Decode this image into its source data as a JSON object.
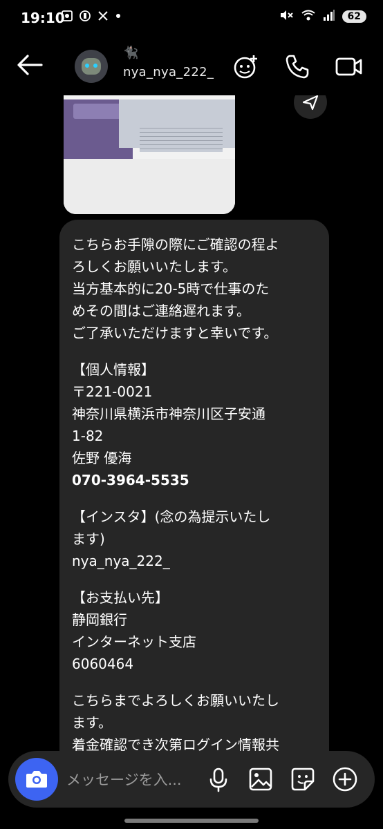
{
  "status_bar": {
    "time": "19:10",
    "battery": "62",
    "left_icons": [
      "screen-record-icon",
      "app-icon",
      "x-app-icon",
      "dot-icon"
    ],
    "right_icons": [
      "mute-icon",
      "wifi-icon",
      "signal-icon",
      "battery-icon"
    ]
  },
  "header": {
    "username": "nya_nya_222_",
    "username_emoji": "🐈‍⬛",
    "icons": [
      "back-arrow-icon",
      "effects-icon",
      "phone-icon",
      "video-icon"
    ]
  },
  "message": {
    "lines": [
      "こちらお手隙の際にご確認の程よ",
      "ろしくお願いいたします。",
      "当方基本的に20-5時で仕事のた",
      "めその間はご連絡遅れます。",
      "ご了承いただけますと幸いです。",
      "",
      "【個人情報】",
      "〒221-0021",
      "神奈川県横浜市神奈川区子安通",
      "1-82",
      "佐野 優海",
      "070-3964-5535",
      "",
      "【インスタ】(念の為提示いたし",
      "ます)",
      "nya_nya_222_",
      "",
      "【お支払い先】",
      "静岡銀行",
      "インターネット支店",
      "6060464",
      "",
      "こちらまでよろしくお願いいたし",
      "ます。",
      "着金確認でき次第ログイン情報共"
    ]
  },
  "composer": {
    "placeholder": "メッセージを入...",
    "icons": [
      "camera-icon",
      "microphone-icon",
      "gallery-icon",
      "sticker-icon",
      "plus-icon"
    ]
  },
  "colors": {
    "background": "#000000",
    "bubble": "#262626",
    "camera_button": "#3d64f2",
    "text": "#ffffff"
  }
}
